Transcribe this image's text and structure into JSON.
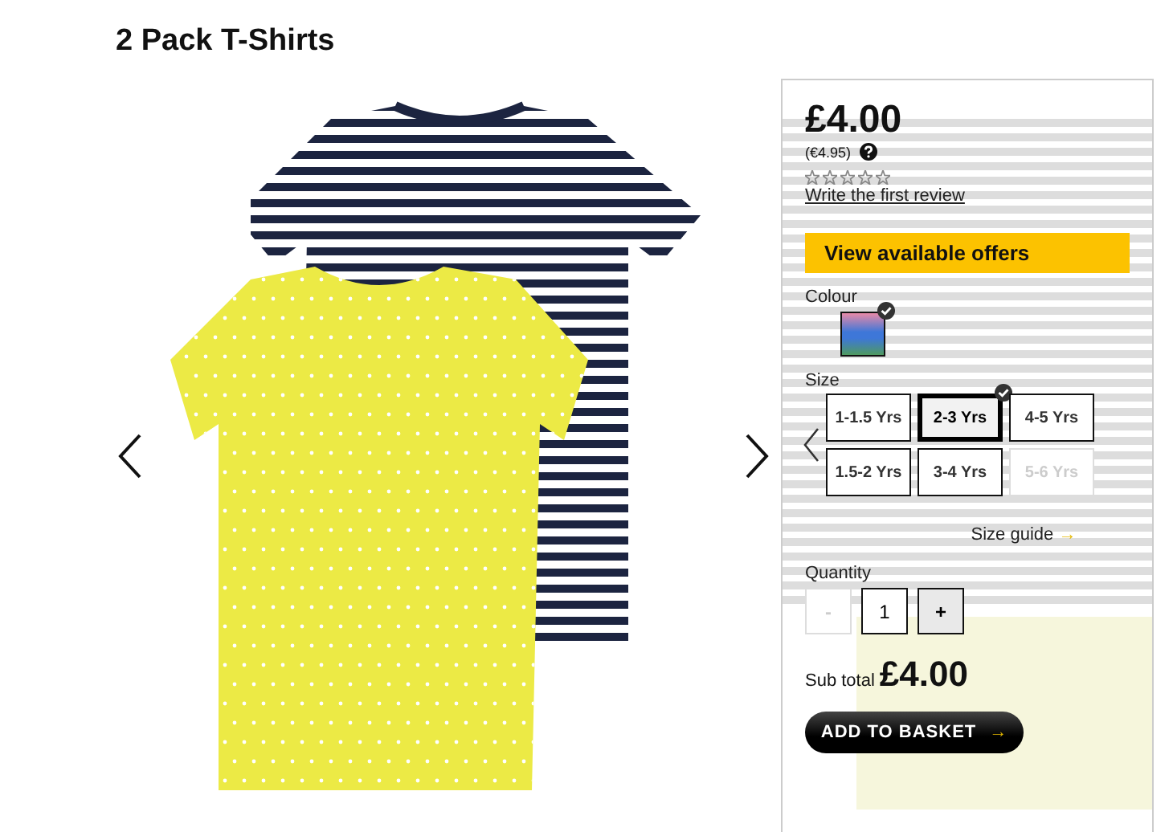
{
  "product": {
    "title": "2 Pack T-Shirts"
  },
  "panel": {
    "price": "£4.00",
    "alt_price": "(€4.95)",
    "stars": 0,
    "review_link": "Write the first review",
    "offers_button": "View available offers",
    "colour_label": "Colour",
    "swatches": [
      {
        "selected": true
      }
    ],
    "size_label": "Size",
    "sizes": [
      {
        "label": "1-1.5 Yrs",
        "selected": false,
        "disabled": false
      },
      {
        "label": "2-3 Yrs",
        "selected": true,
        "disabled": false
      },
      {
        "label": "4-5 Yrs",
        "selected": false,
        "disabled": false
      },
      {
        "label": "1.5-2 Yrs",
        "selected": false,
        "disabled": false
      },
      {
        "label": "3-4 Yrs",
        "selected": false,
        "disabled": false
      },
      {
        "label": "5-6 Yrs",
        "selected": false,
        "disabled": true
      }
    ],
    "size_guide": "Size guide",
    "size_guide_arrow": "→",
    "quantity_label": "Quantity",
    "minus": {
      "label": "-",
      "disabled": true
    },
    "quantity": "1",
    "plus": {
      "label": "+",
      "disabled": false
    },
    "subtotal_label": "Sub total",
    "subtotal": "£4.00",
    "add_button": "ADD TO BASKET",
    "add_arrow": "→"
  }
}
